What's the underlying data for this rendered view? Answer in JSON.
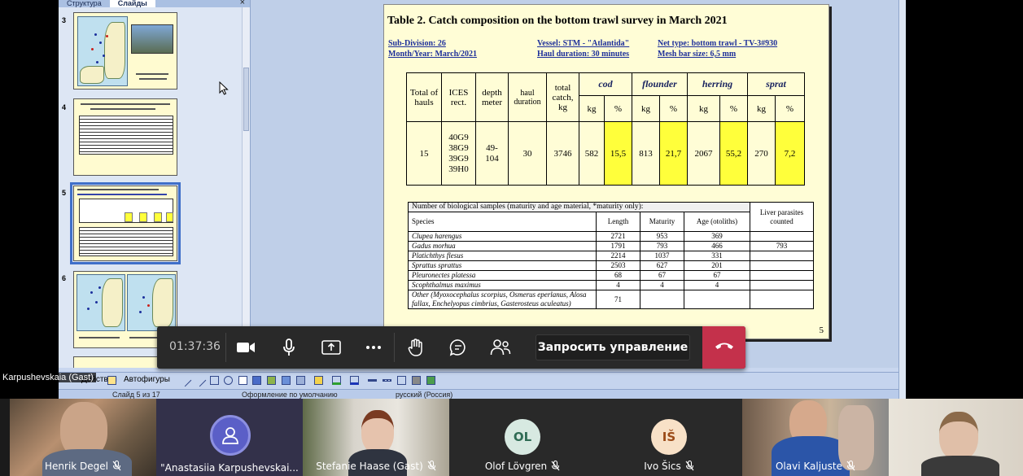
{
  "slides_panel": {
    "tabs": [
      "Структура",
      "Слайды"
    ],
    "active_tab": "Слайды",
    "close_glyph": "×",
    "slides": [
      {
        "number": "3"
      },
      {
        "number": "4"
      },
      {
        "number": "5",
        "selected": true
      },
      {
        "number": "6"
      }
    ]
  },
  "slide": {
    "title": "Table 2. Catch composition on the bottom trawl survey in March 2021",
    "meta": {
      "sub_division": "Sub-Division: 26",
      "month_year": "Month/Year: March/2021",
      "vessel": "Vessel: STM - \"Atlantida\"",
      "haul_duration": "Haul duration:  30 minutes",
      "net_type": "Net type: bottom trawl - TV-3#930",
      "mesh": "Mesh bar size: 6,5 mm"
    },
    "catch_table": {
      "headers": {
        "total_hauls": "Total of hauls",
        "ices": "ICES rect.",
        "depth": "depth meter",
        "haul_duration": "haul duration",
        "total_catch": "total catch, kg"
      },
      "species": [
        "cod",
        "flounder",
        "herring",
        "sprat"
      ],
      "unit_kg": "kg",
      "unit_pct": "%",
      "row": {
        "total_hauls": "15",
        "ices": "40G9\n38G9\n39G9\n39H0",
        "depth": "49-\n104",
        "haul_duration": "30",
        "total_catch": "3746",
        "cod_kg": "582",
        "cod_pct": "15,5",
        "flounder_kg": "813",
        "flounder_pct": "21,7",
        "herring_kg": "2067",
        "herring_pct": "55,2",
        "sprat_kg": "270",
        "sprat_pct": "7,2"
      }
    },
    "bio_table": {
      "caption": "Number of biological samples (maturity and age material, *maturity only):",
      "liver_header": "Liver parasites counted",
      "columns": [
        "Species",
        "Length",
        "Maturity",
        "Age (otoliths)"
      ],
      "rows": [
        {
          "species": "Clupea harengus",
          "length": "2721",
          "maturity": "953",
          "age": "369",
          "liver": ""
        },
        {
          "species": "Gadus morhua",
          "length": "1791",
          "maturity": "793",
          "age": "466",
          "liver": "793"
        },
        {
          "species": "Platichthys flesus",
          "length": "2214",
          "maturity": "1037",
          "age": "331",
          "liver": ""
        },
        {
          "species": "Sprattus sprattus",
          "length": "2503",
          "maturity": "627",
          "age": "201",
          "liver": ""
        },
        {
          "species": "Pleuronectes platessa",
          "length": "68",
          "maturity": "67",
          "age": "67",
          "liver": ""
        },
        {
          "species": "Scophthalmus maximus",
          "length": "4",
          "maturity": "4",
          "age": "4",
          "liver": ""
        },
        {
          "species": "Other (Myoxocephalus scorpius, Osmerus eperlanus, Alosa fallax, Enchelyopus cimbrius, Gasterosteus aculeatus)",
          "length": "71",
          "maturity": "",
          "age": "",
          "liver": ""
        }
      ]
    },
    "page_number": "5"
  },
  "ppt_toolbar": {
    "actions_label": "Действия",
    "autoshapes_label": "Автофигуры"
  },
  "status_bar": {
    "slide_of": "Слайд 5 из 17",
    "design": "Оформление по умолчанию",
    "language": "русский (Россия)"
  },
  "presenter_label": "Karpushevskaia (Gast)",
  "meeting_controls": {
    "timer": "01:37:36",
    "request_control": "Запросить управление",
    "icons": [
      "camera-icon",
      "microphone-icon",
      "share-screen-icon",
      "more-icon",
      "raise-hand-icon",
      "chat-icon",
      "participants-icon",
      "hang-up-icon"
    ]
  },
  "participants": [
    {
      "name": "Henrik Degel",
      "type": "video",
      "muted": true
    },
    {
      "name": "\"Anastasiia Karpushevskai...",
      "type": "avatar-photo",
      "muted": false
    },
    {
      "name": "Stefanie Haase (Gast)",
      "type": "video",
      "muted": true
    },
    {
      "name": "Olof Lövgren",
      "type": "initials",
      "initials": "OL",
      "avatar_color": "#d7e9e1",
      "initials_color": "#2f6b54",
      "muted": true
    },
    {
      "name": "Ivo Šics",
      "type": "initials",
      "initials": "IŠ",
      "avatar_color": "#f8e1c7",
      "initials_color": "#9b4a17",
      "muted": true
    },
    {
      "name": "Olavi Kaljuste",
      "type": "video",
      "muted": true
    },
    {
      "name": "",
      "type": "video",
      "muted": false
    }
  ],
  "colors": {
    "slide_bg": "#fffdd6",
    "highlight_yellow": "#ffff3b",
    "meta_blue": "#1d2f9a",
    "hangup_red": "#c4314b",
    "controls_bg": "#292929"
  }
}
